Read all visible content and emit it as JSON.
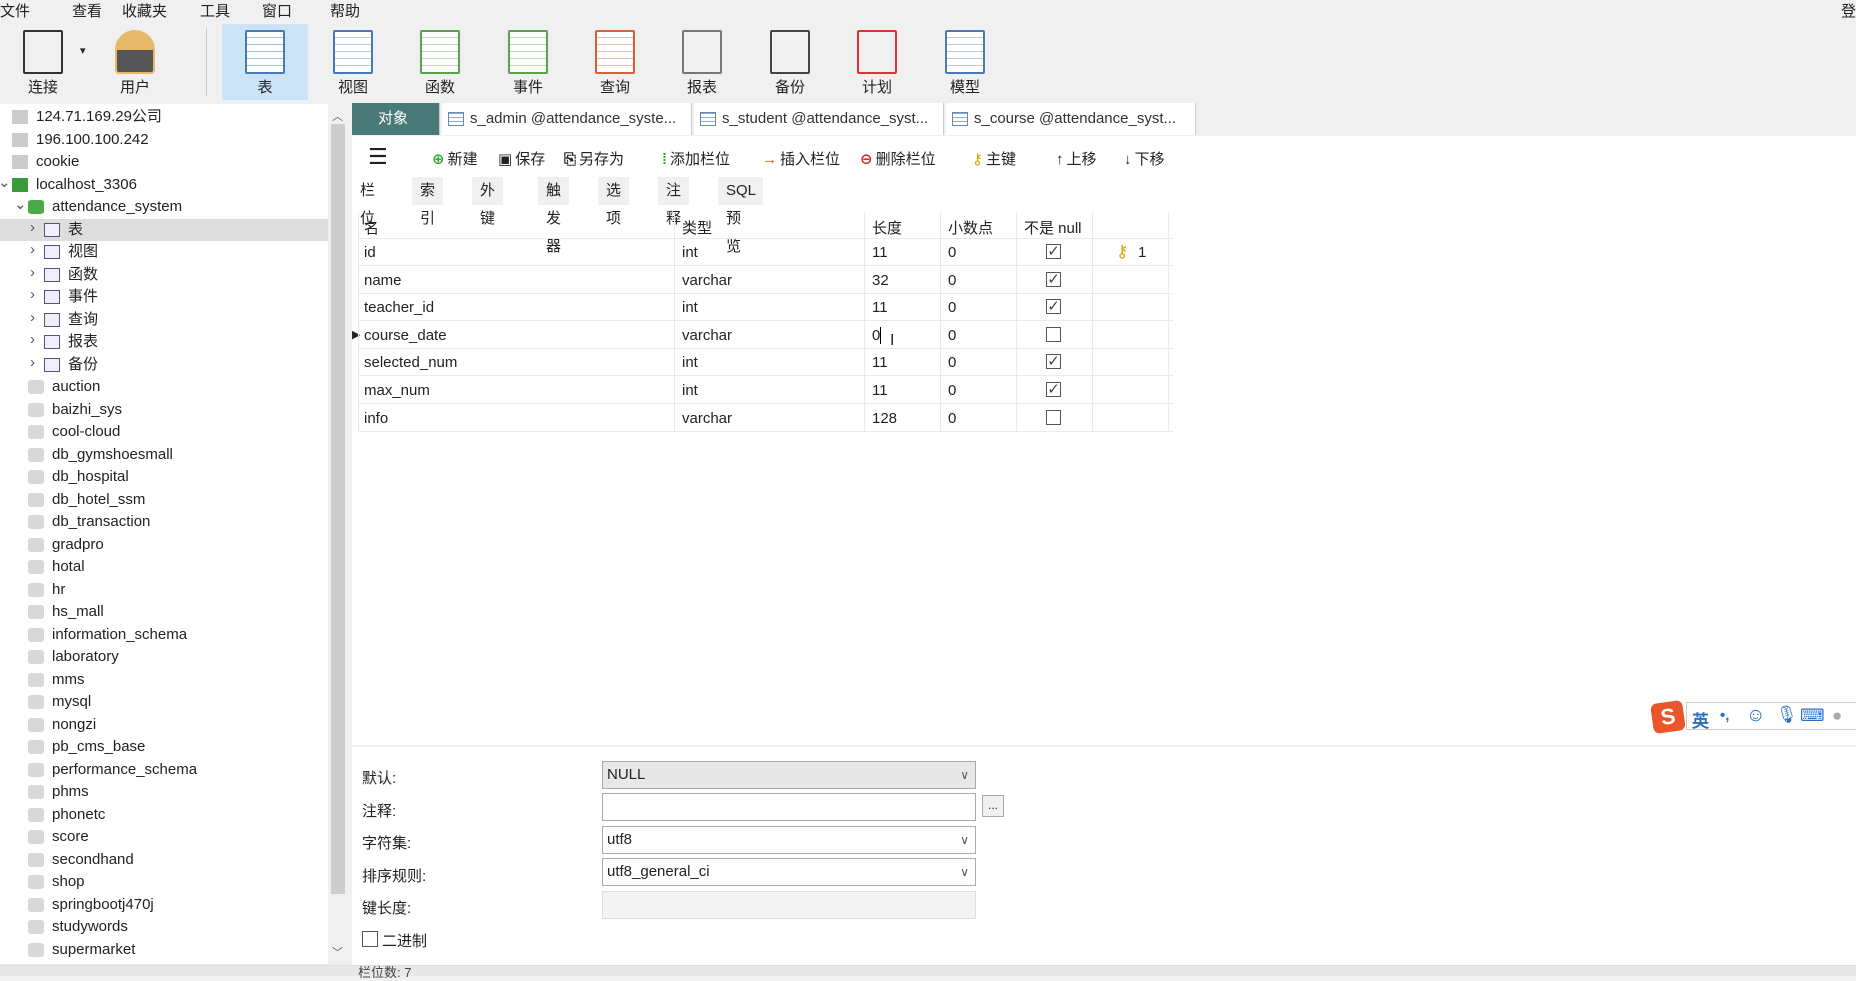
{
  "menu": [
    "文件",
    "查看",
    "收藏夹",
    "工具",
    "窗口",
    "帮助"
  ],
  "menu_right": "登",
  "toolbar": [
    {
      "label": "连接",
      "icon": "plug-icon"
    },
    {
      "label": "用户",
      "icon": "user-icon"
    },
    {
      "label": "表",
      "icon": "table-icon"
    },
    {
      "label": "视图",
      "icon": "view-icon"
    },
    {
      "label": "函数",
      "icon": "function-icon"
    },
    {
      "label": "事件",
      "icon": "event-icon"
    },
    {
      "label": "查询",
      "icon": "query-icon"
    },
    {
      "label": "报表",
      "icon": "report-icon"
    },
    {
      "label": "备份",
      "icon": "backup-icon"
    },
    {
      "label": "计划",
      "icon": "schedule-icon"
    },
    {
      "label": "模型",
      "icon": "model-icon"
    }
  ],
  "sidebar": {
    "connections": [
      "124.71.169.29公司",
      "196.100.100.242",
      "cookie",
      "localhost_3306"
    ],
    "database": "attendance_system",
    "db_children": [
      "表",
      "视图",
      "函数",
      "事件",
      "查询",
      "报表",
      "备份"
    ],
    "databases": [
      "auction",
      "baizhi_sys",
      "cool-cloud",
      "db_gymshoesmall",
      "db_hospital",
      "db_hotel_ssm",
      "db_transaction",
      "gradpro",
      "hotal",
      "hr",
      "hs_mall",
      "information_schema",
      "laboratory",
      "mms",
      "mysql",
      "nongzi",
      "pb_cms_base",
      "performance_schema",
      "phms",
      "phonetc",
      "score",
      "secondhand",
      "shop",
      "springbootj470j",
      "studywords",
      "supermarket"
    ]
  },
  "tabs": [
    "对象",
    "s_admin @attendance_syste...",
    "s_student @attendance_syst...",
    "s_course @attendance_syst..."
  ],
  "content_toolbar": [
    "新建",
    "保存",
    "另存为",
    "添加栏位",
    "插入栏位",
    "删除栏位",
    "主键",
    "上移",
    "下移"
  ],
  "subtabs": [
    "栏位",
    "索引",
    "外键",
    "触发器",
    "选项",
    "注释",
    "SQL 预览"
  ],
  "grid": {
    "headers": [
      "名",
      "类型",
      "长度",
      "小数点",
      "不是 null",
      ""
    ],
    "rows": [
      {
        "name": "id",
        "type": "int",
        "length": "11",
        "decimals": "0",
        "not_null": true,
        "key": "1"
      },
      {
        "name": "name",
        "type": "varchar",
        "length": "32",
        "decimals": "0",
        "not_null": true,
        "key": ""
      },
      {
        "name": "teacher_id",
        "type": "int",
        "length": "11",
        "decimals": "0",
        "not_null": true,
        "key": ""
      },
      {
        "name": "course_date",
        "type": "varchar",
        "length": "0",
        "decimals": "0",
        "not_null": false,
        "key": ""
      },
      {
        "name": "selected_num",
        "type": "int",
        "length": "11",
        "decimals": "0",
        "not_null": true,
        "key": ""
      },
      {
        "name": "max_num",
        "type": "int",
        "length": "11",
        "decimals": "0",
        "not_null": true,
        "key": ""
      },
      {
        "name": "info",
        "type": "varchar",
        "length": "128",
        "decimals": "0",
        "not_null": false,
        "key": ""
      }
    ]
  },
  "form": {
    "default_label": "默认:",
    "default_value": "NULL",
    "comment_label": "注释:",
    "comment_value": "",
    "ellipsis": "...",
    "charset_label": "字符集:",
    "charset_value": "utf8",
    "collation_label": "排序规则:",
    "collation_value": "utf8_general_ci",
    "keylen_label": "键长度:",
    "binary_label": "二进制"
  },
  "ime": {
    "lang": "英",
    "punct": "•,"
  },
  "status": "栏位数: 7"
}
